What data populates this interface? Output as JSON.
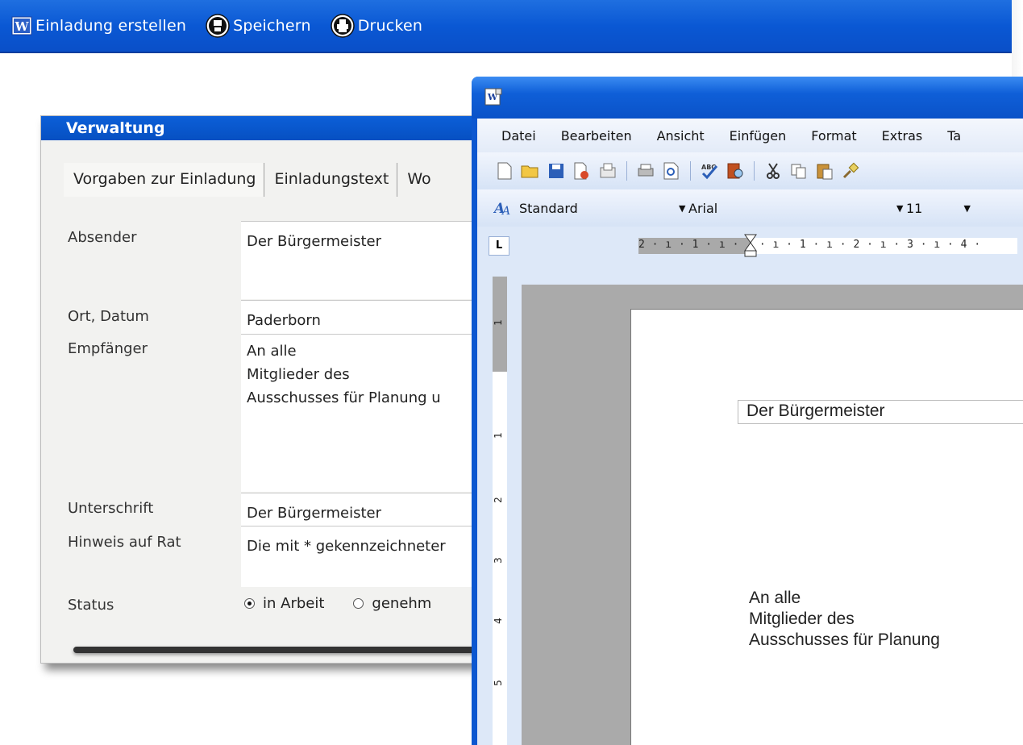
{
  "topbar": {
    "create_label": "Einladung erstellen",
    "save_label": "Speichern",
    "print_label": "Drucken"
  },
  "form": {
    "title": "Verwaltung",
    "tabs": [
      "Vorgaben zur Einladung",
      "Einladungstext",
      "Wo"
    ],
    "labels": {
      "absender": "Absender",
      "ort_datum": "Ort, Datum",
      "empfaenger": "Empfänger",
      "unterschrift": "Unterschrift",
      "hinweis": "Hinweis auf Rat",
      "status": "Status"
    },
    "values": {
      "absender": "Der Bürgermeister",
      "ort_datum": "Paderborn",
      "empfaenger_1": "An alle",
      "empfaenger_2": "Mitglieder des",
      "empfaenger_3": "Ausschusses für Planung u",
      "unterschrift": "Der Bürgermeister",
      "hinweis": "Die mit * gekennzeichneter"
    },
    "status_options": [
      "in Arbeit",
      "genehm"
    ],
    "status_selected": "in Arbeit"
  },
  "word": {
    "menu": [
      "Datei",
      "Bearbeiten",
      "Ansicht",
      "Einfügen",
      "Format",
      "Extras",
      "Ta"
    ],
    "style_value": "Standard",
    "font_value": "Arial",
    "size_value": "11",
    "ruler_corner": "L",
    "h_ruler_text": "2 · ı · 1 · ı ·   · ı · 1 · ı · 2 · ı · 3 · ı · 4 ·",
    "v_ruler_numbers": [
      "1",
      "1",
      "2",
      "3",
      "4",
      "5"
    ],
    "doc_line_1": "Der Bürgermeister",
    "doc_line_2": "An alle",
    "doc_line_3": "Mitglieder des",
    "doc_line_4": "Ausschusses für Planung"
  }
}
